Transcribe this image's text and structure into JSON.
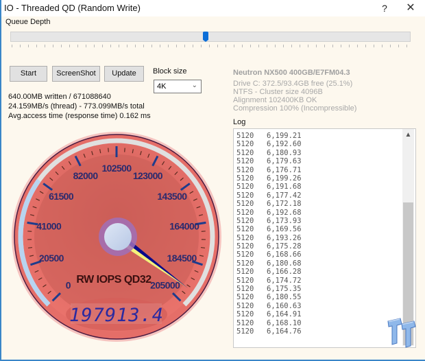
{
  "window": {
    "title": "IO - Threaded QD (Random Write)",
    "help_label": "?",
    "close_label": "✕"
  },
  "queue_depth": {
    "label": "Queue Depth",
    "slider_fraction": 0.49
  },
  "toolbar": {
    "start_label": "Start",
    "screenshot_label": "ScreenShot",
    "update_label": "Update"
  },
  "block_size": {
    "label": "Block size",
    "selected": "4K"
  },
  "stats": {
    "written": "640.00MB written / 671088640",
    "throughput": "24.159MB/s (thread) - 773.099MB/s total",
    "access_time": "Avg.access time (response time) 0.162 ms"
  },
  "drive_info": {
    "model": "Neutron NX500 400GB/E7FM04.3",
    "drive": "Drive C: 372.5/93.4GB free (25.1%)",
    "fs": "NTFS - Cluster size 4096B",
    "alignment": "Alignment 102400KB OK",
    "compression": "Compression 100% (Incompressible)"
  },
  "log": {
    "label": "Log",
    "rows": [
      [
        "5120",
        "6,199.21"
      ],
      [
        "5120",
        "6,192.60"
      ],
      [
        "5120",
        "6,180.93"
      ],
      [
        "5120",
        "6,179.63"
      ],
      [
        "5120",
        "6,176.71"
      ],
      [
        "5120",
        "6,199.26"
      ],
      [
        "5120",
        "6,191.68"
      ],
      [
        "5120",
        "6,177.42"
      ],
      [
        "5120",
        "6,172.18"
      ],
      [
        "5120",
        "6,192.68"
      ],
      [
        "5120",
        "6,173.93"
      ],
      [
        "5120",
        "6,169.56"
      ],
      [
        "5120",
        "6,193.26"
      ],
      [
        "5120",
        "6,175.28"
      ],
      [
        "5120",
        "6,168.66"
      ],
      [
        "5120",
        "6,180.68"
      ],
      [
        "5120",
        "6,166.28"
      ],
      [
        "5120",
        "6,174.72"
      ],
      [
        "5120",
        "6,175.35"
      ],
      [
        "5120",
        "6,180.55"
      ],
      [
        "5120",
        "6,160.63"
      ],
      [
        "5120",
        "6,164.91"
      ],
      [
        "5120",
        "6,168.10"
      ],
      [
        "5120",
        "6,164.76"
      ]
    ],
    "scroll_up_icon": "▲"
  },
  "gauge": {
    "title": "RW IOPS QD32",
    "readout": "197913.4",
    "value": 197913.4,
    "min": 0,
    "max": 205000,
    "major_labels": [
      "0",
      "20500",
      "41000",
      "61500",
      "82000",
      "102500",
      "123000",
      "143500",
      "164000",
      "184500",
      "205000"
    ],
    "colors": {
      "face": "#e8716b",
      "face_inner": "#c95e58",
      "label": "#2a2a6e",
      "major_tick": "#1e3c8c",
      "needle": "#0a0a8a",
      "needle_highlight": "#f5f07a",
      "arc_fill": "#b8d4f0",
      "arc_empty": "#e0e0e0",
      "lcd_digits": "#2a2aa0"
    }
  }
}
